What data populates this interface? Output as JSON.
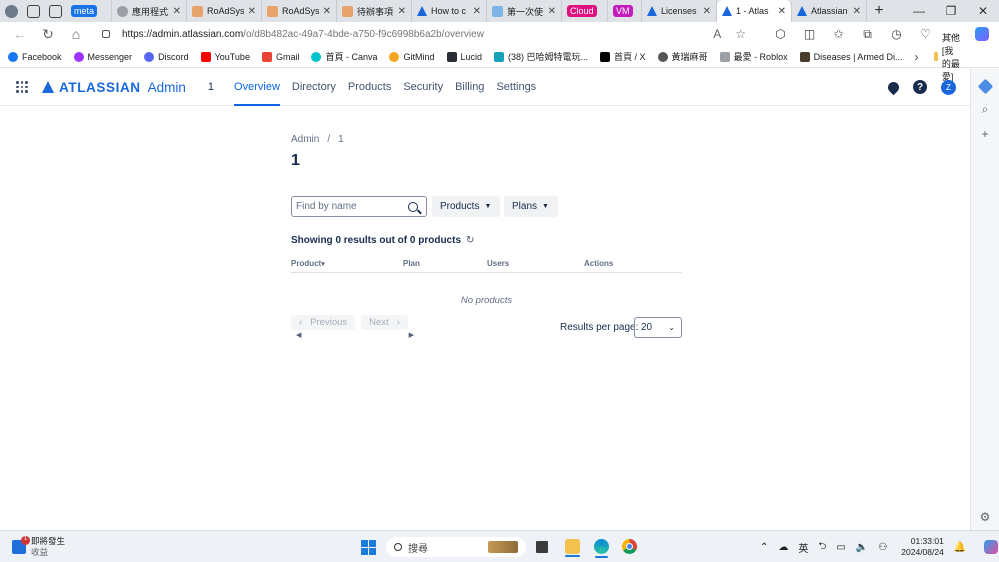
{
  "browser": {
    "tabs": [
      {
        "title": "meta",
        "color": "#1a73e8",
        "pill": true
      },
      {
        "title": "應用程式",
        "color": "#9aa0a6",
        "pill": false
      },
      {
        "title": "RoAdSyst",
        "color": "#e8a36a",
        "pill": false
      },
      {
        "title": "RoAdSyst",
        "color": "#e8a36a",
        "pill": false
      },
      {
        "title": "待辦事項",
        "color": "#e8a36a",
        "pill": false
      },
      {
        "title": "How to c",
        "color": "#1868db",
        "pill": false
      },
      {
        "title": "第一次使",
        "color": "#7fb5e6",
        "pill": false
      },
      {
        "title": "Cloud",
        "color": "#e0117f",
        "pill": true
      },
      {
        "title": "VM",
        "color": "#c41cbd",
        "pill": true
      },
      {
        "title": "Licenses",
        "color": "#1868db",
        "pill": false
      },
      {
        "title": "1 - Atlas",
        "color": "#1868db",
        "pill": false,
        "active": true
      },
      {
        "title": "Atlassian",
        "color": "#1868db",
        "pill": false
      }
    ],
    "url_host": "https://admin.atlassian.com",
    "url_path": "/o/d8b482ac-49a7-4bde-a750-f9c6998b6a2b/overview",
    "bookmarks": [
      {
        "label": "Facebook",
        "color": "#1877f2"
      },
      {
        "label": "Messenger",
        "color": "#a033ff"
      },
      {
        "label": "Discord",
        "color": "#5865f2"
      },
      {
        "label": "YouTube",
        "color": "#ff0000"
      },
      {
        "label": "Gmail",
        "color": "#ea4335"
      },
      {
        "label": "首頁 - Canva",
        "color": "#00c4cc"
      },
      {
        "label": "GitMind",
        "color": "#f5a623"
      },
      {
        "label": "Lucid",
        "color": "#282c33"
      },
      {
        "label": "(38) 巴哈姆特電玩...",
        "color": "#17a2b8"
      },
      {
        "label": "首頁 / X",
        "color": "#000000"
      },
      {
        "label": "黃瑞麻哥",
        "color": "#555555"
      },
      {
        "label": "最愛 - Roblox",
        "color": "#9aa0a6"
      },
      {
        "label": "Diseases | Armed Di...",
        "color": "#4a3b2a"
      }
    ],
    "bookmarks_folder": "其他 [我的最愛]"
  },
  "app": {
    "brand": "ATLASSIAN",
    "product": "Admin",
    "org": "1",
    "nav": [
      "Overview",
      "Directory",
      "Products",
      "Security",
      "Billing",
      "Settings"
    ],
    "active_nav": "Overview",
    "avatar_initial": "Z",
    "help_glyph": "?"
  },
  "main": {
    "breadcrumb": {
      "root": "Admin",
      "separator": "/",
      "current": "1"
    },
    "title": "1",
    "search_placeholder": "Find by name",
    "filters": {
      "products": "Products",
      "plans": "Plans"
    },
    "summary": "Showing 0 results out of 0 products",
    "table": {
      "columns": [
        "Product",
        "Plan",
        "Users",
        "Actions"
      ],
      "sort_indicator": "▾",
      "empty_text": "No products"
    },
    "pagination": {
      "previous": "Previous",
      "next": "Next"
    },
    "results_per_page": {
      "label": "Results per page:",
      "value": "20"
    }
  },
  "taskbar": {
    "weather_title": "即將發生",
    "weather_sub": "收益",
    "notification_count": "1",
    "search_placeholder": "搜尋",
    "ime": "英",
    "time": "01:33:01",
    "date": "2024/08/24"
  }
}
